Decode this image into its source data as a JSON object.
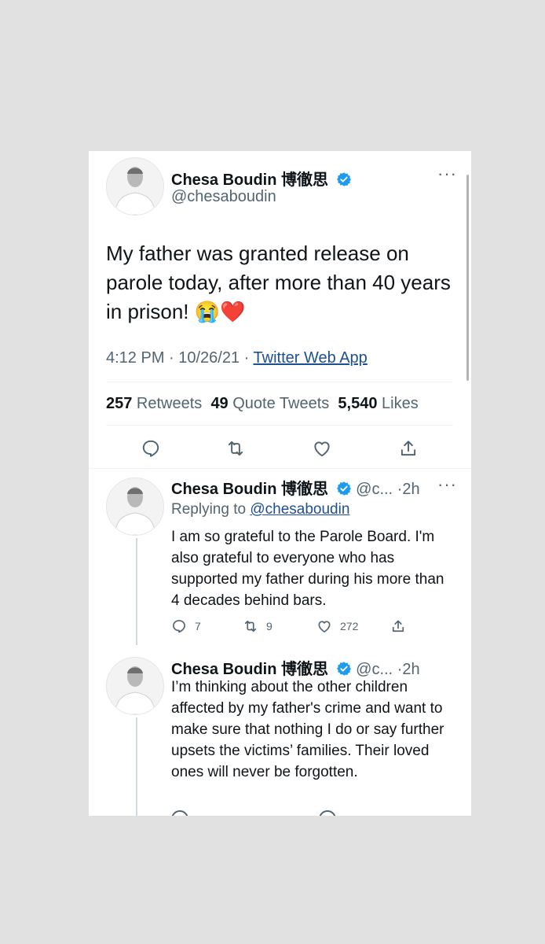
{
  "main_tweet": {
    "author_name": "Chesa Boudin 博徹思",
    "handle": "@chesaboudin",
    "text": "My father was granted release on parole today, after more than 40 years in prison! 😭❤️",
    "time": "4:12 PM · 10/26/21 · ",
    "source": "Twitter Web App",
    "retweets_count": "257",
    "retweets_label": " Retweets",
    "quotes_count": "49",
    "quotes_label": " Quote Tweets",
    "likes_count": "5,540",
    "likes_label": " Likes"
  },
  "replies": [
    {
      "author_name": "Chesa Boudin 博徹思",
      "handle_time": "@c... ·2h",
      "replying_label": "Replying to ",
      "replying_handle": "@chesaboudin",
      "text": "I am so grateful to the Parole Board. I'm also grateful to everyone who has supported my father during his more than 4 decades behind bars.",
      "reply_count": "7",
      "retweet_count": "9",
      "like_count": "272"
    },
    {
      "author_name": "Chesa Boudin 博徹思",
      "handle_time": "@c... ·2h",
      "text": "I’m thinking about the other children affected by my father's crime and want to make sure that nothing I do or say further upsets the victims’ families. Their loved ones will never be forgotten."
    }
  ],
  "icons": [
    "verified-icon",
    "more-icon",
    "reply-icon",
    "retweet-icon",
    "like-icon",
    "share-icon"
  ],
  "colors": {
    "verified": "#1d9bf0",
    "link": "#1d4f91",
    "muted": "#536471",
    "text": "#0f1419"
  }
}
